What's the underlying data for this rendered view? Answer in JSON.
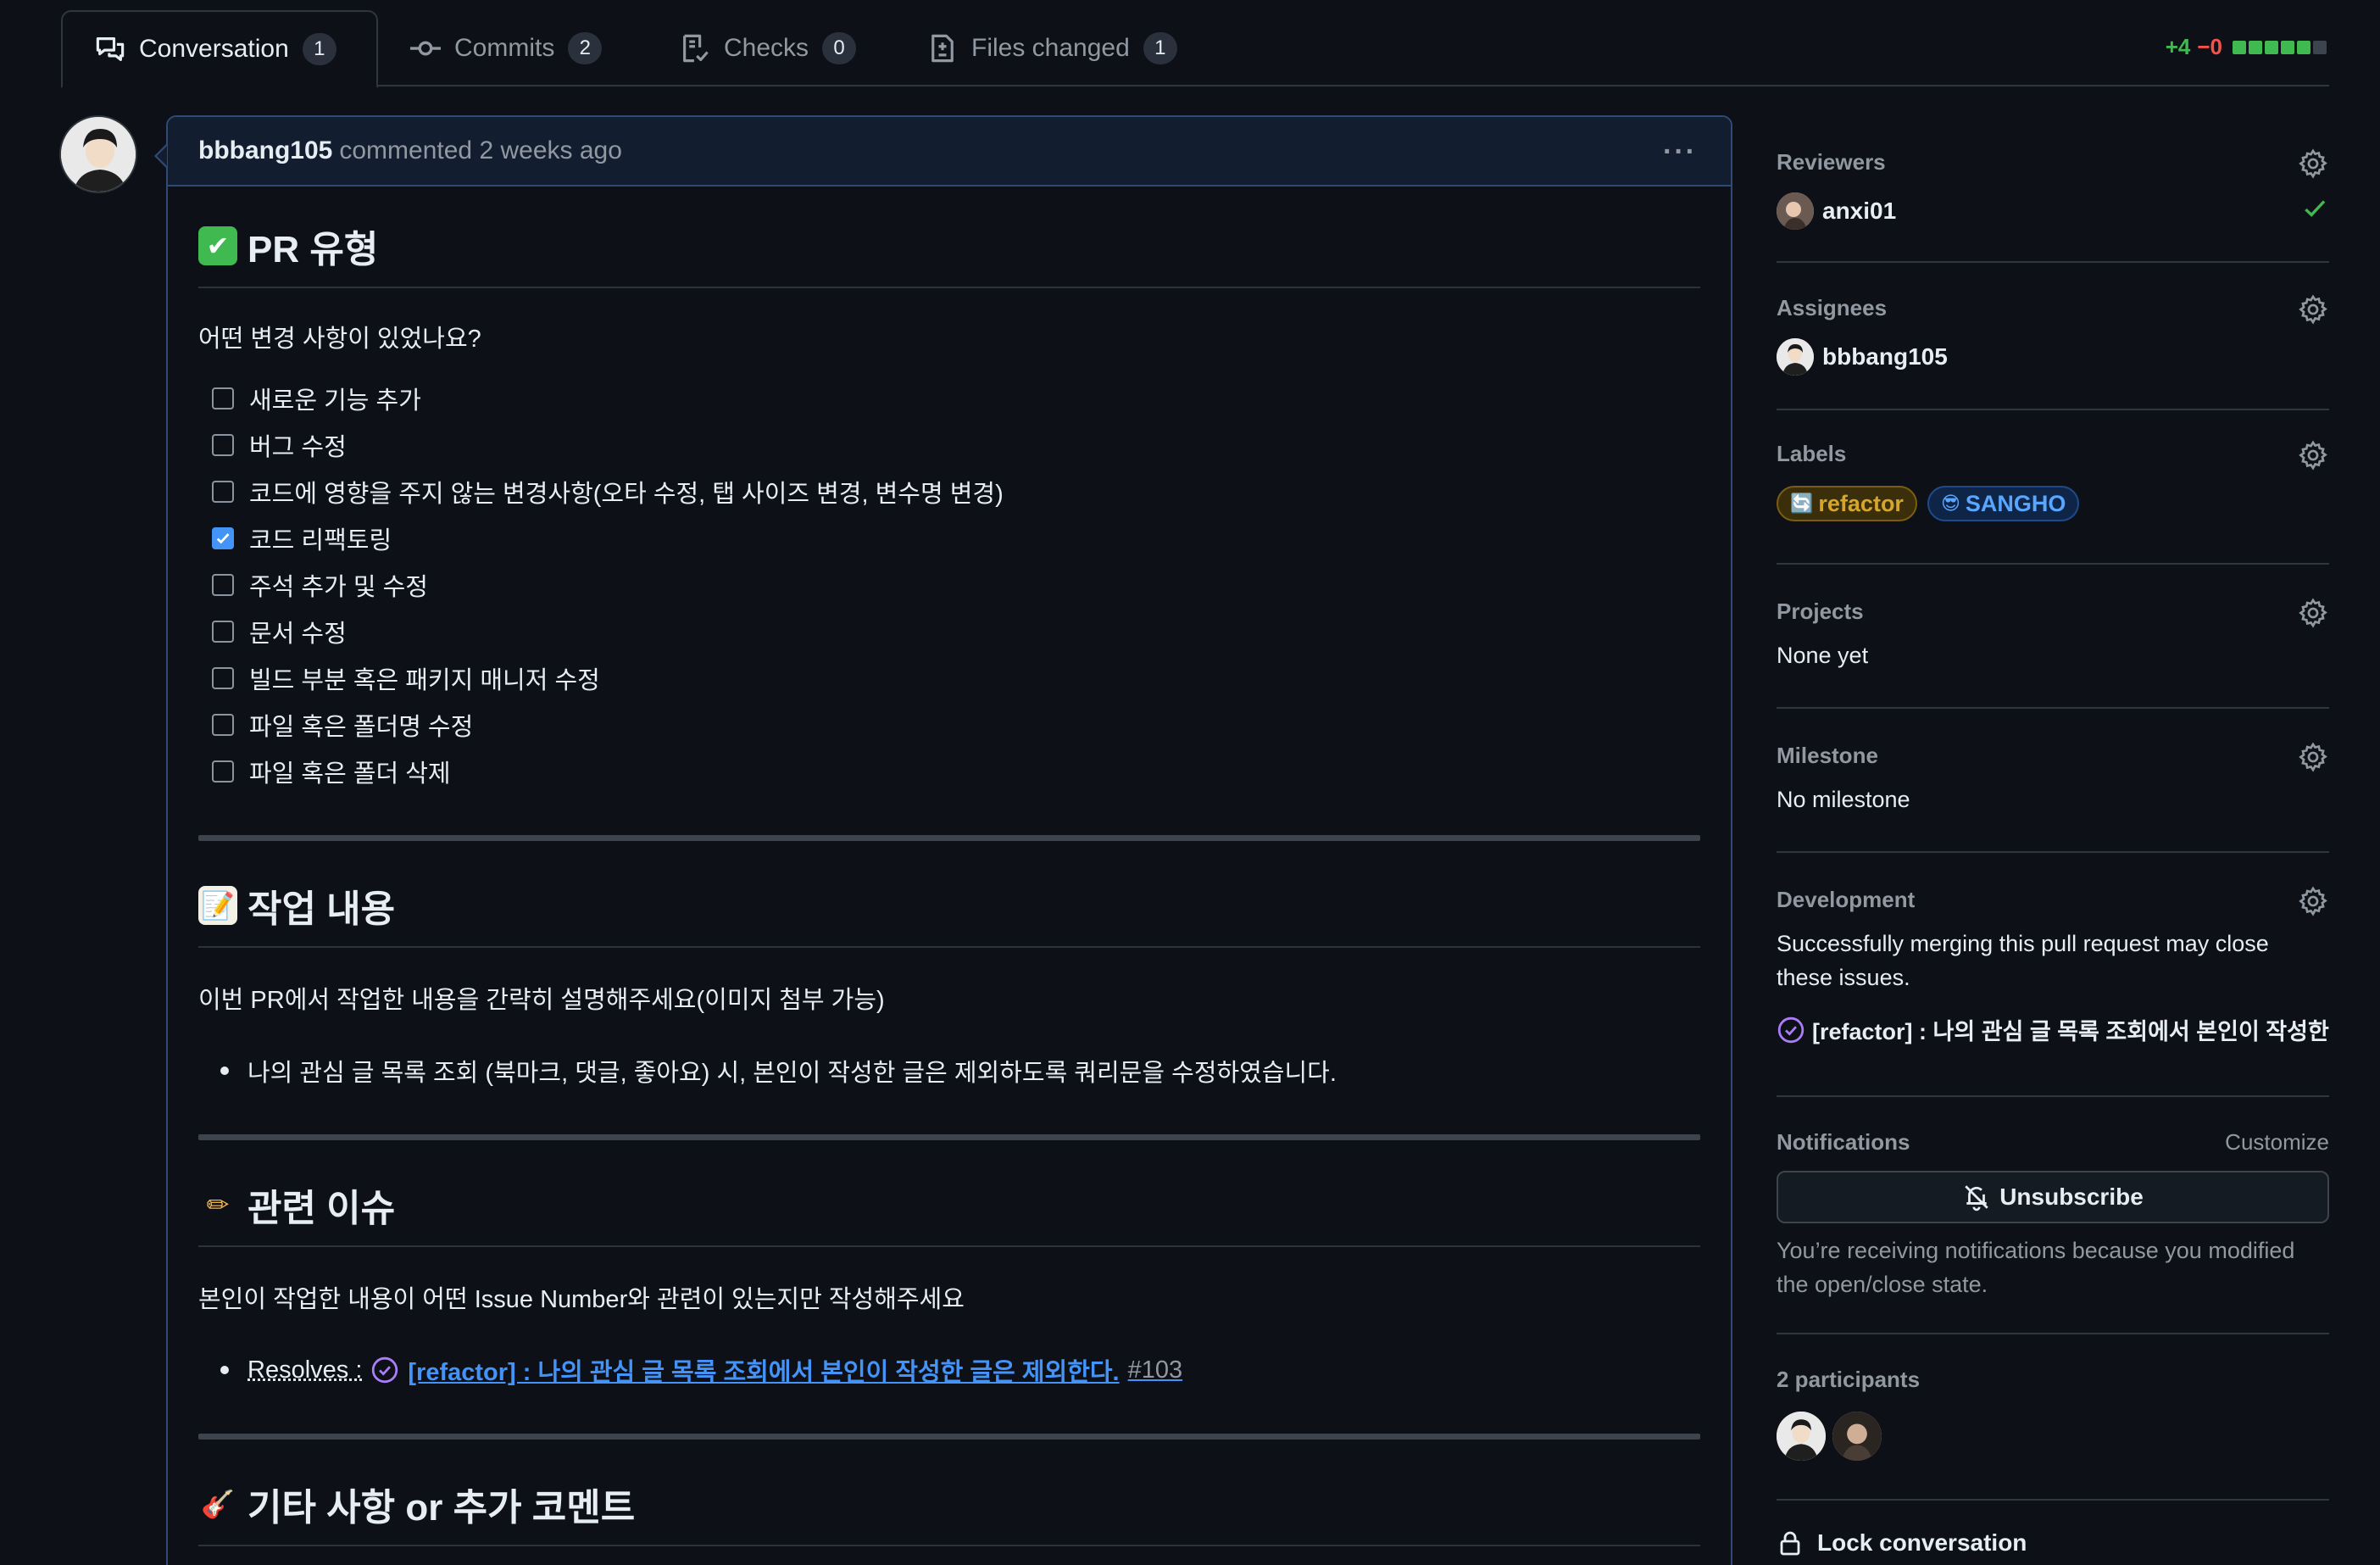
{
  "tabs": [
    {
      "label": "Conversation",
      "count": "1",
      "icon": "comment-discussion-icon"
    },
    {
      "label": "Commits",
      "count": "2",
      "icon": "git-commit-icon"
    },
    {
      "label": "Checks",
      "count": "0",
      "icon": "checklist-icon"
    },
    {
      "label": "Files changed",
      "count": "1",
      "icon": "file-diff-icon"
    }
  ],
  "diffstat": {
    "additions": "+4",
    "deletions": "−0",
    "blocks": [
      "#3fb950",
      "#3fb950",
      "#3fb950",
      "#3fb950",
      "#3fb950",
      "#3d444d"
    ]
  },
  "comment": {
    "author": "bbbang105",
    "meta": "commented 2 weeks ago",
    "menu": "···",
    "sections": {
      "pr_type": {
        "emoji": "✔",
        "title": "PR 유형",
        "question": "어떤 변경 사항이 있었나요?",
        "items": [
          {
            "label": "새로운 기능 추가",
            "checked": false
          },
          {
            "label": "버그 수정",
            "checked": false
          },
          {
            "label": "코드에 영향을 주지 않는 변경사항(오타 수정, 탭 사이즈 변경, 변수명 변경)",
            "checked": false
          },
          {
            "label": "코드 리팩토링",
            "checked": true
          },
          {
            "label": "주석 추가 및 수정",
            "checked": false
          },
          {
            "label": "문서 수정",
            "checked": false
          },
          {
            "label": "빌드 부분 혹은 패키지 매니저 수정",
            "checked": false
          },
          {
            "label": "파일 혹은 폴더명 수정",
            "checked": false
          },
          {
            "label": "파일 혹은 폴더 삭제",
            "checked": false
          }
        ]
      },
      "work": {
        "emoji": "📝",
        "title": "작업 내용",
        "description": "이번 PR에서 작업한 내용을 간략히 설명해주세요(이미지 첨부 가능)",
        "bullet": "나의 관심 글 목록 조회 (북마크, 댓글, 좋아요) 시, 본인이 작성한 글은 제외하도록 쿼리문을 수정하였습니다."
      },
      "issue": {
        "emoji": "✏",
        "title": "관련 이슈",
        "description": "본인이 작업한 내용이 어떤 Issue Number와 관련이 있는지만 작성해주세요",
        "resolves_label": "Resolves :",
        "issue_title": "[refactor] : 나의 관심 글 목록 조회에서 본인이 작성한 글은 제외한다.",
        "issue_number": "#103"
      },
      "etc": {
        "emoji": "🎸",
        "title": "기타 사항 or 추가 코멘트"
      }
    }
  },
  "sidebar": {
    "reviewers": {
      "title": "Reviewers",
      "name": "anxi01",
      "status_color": "#3fb950"
    },
    "assignees": {
      "title": "Assignees",
      "name": "bbbang105"
    },
    "labels": {
      "title": "Labels",
      "items": [
        {
          "name": "refactor",
          "emoji": "🔄",
          "color": "#d4a72c",
          "bg": "#3b2e0a"
        },
        {
          "name": "SANGHO",
          "emoji": "😎",
          "color": "#58a6ff",
          "bg": "#0f2548"
        }
      ]
    },
    "projects": {
      "title": "Projects",
      "value": "None yet"
    },
    "milestone": {
      "title": "Milestone",
      "value": "No milestone"
    },
    "development": {
      "title": "Development",
      "text": "Successfully merging this pull request may close these issues.",
      "issue": "[refactor] : 나의 관심 글 목록 조회에서 본인이 작성한..."
    },
    "notifications": {
      "title": "Notifications",
      "customize": "Customize",
      "button": "Unsubscribe",
      "reason": "You’re receiving notifications because you modified the open/close state."
    },
    "participants": {
      "title": "2 participants"
    },
    "lock": {
      "label": "Lock conversation"
    }
  }
}
